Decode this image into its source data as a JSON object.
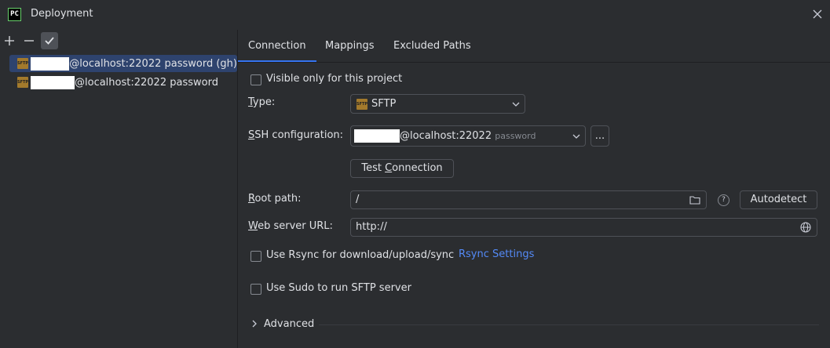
{
  "window": {
    "title": "Deployment",
    "app_icon_text": "PC"
  },
  "left_toolbar": {
    "add": "+",
    "remove": "−",
    "default": "✔"
  },
  "servers": [
    {
      "label": "@localhost:22022 password (gh)",
      "icon": "sftp-icon",
      "selected": true
    },
    {
      "label": "@localhost:22022 password",
      "icon": "sftp-icon",
      "selected": false
    }
  ],
  "tabs": [
    {
      "label": "Connection",
      "active": true
    },
    {
      "label": "Mappings",
      "active": false
    },
    {
      "label": "Excluded Paths",
      "active": false
    }
  ],
  "connection": {
    "visible_only": {
      "label": "Visible only for this project",
      "checked": false
    },
    "type": {
      "label_mnemonic": "T",
      "label_rest": "ype:",
      "value": "SFTP"
    },
    "ssh": {
      "label_mnemonic": "S",
      "label_rest": "SH configuration:",
      "value": "@localhost:22022",
      "hint": "password",
      "more": "..."
    },
    "test_connection": {
      "before": "Test ",
      "mnemonic": "C",
      "after": "onnection"
    },
    "root_path": {
      "label_mnemonic": "R",
      "label_rest": "oot path:",
      "value": "/",
      "autodetect": "Autodetect",
      "help": "?"
    },
    "web_server": {
      "label_mnemonic": "W",
      "label_rest": "eb server URL:",
      "value": "http://"
    },
    "rsync": {
      "label": "Use Rsync for download/upload/sync",
      "checked": false,
      "settings_link": "Rsync Settings"
    },
    "sudo": {
      "label": "Use Sudo to run SFTP server",
      "checked": false
    },
    "advanced": {
      "label": "Advanced",
      "expanded": false
    }
  },
  "colors": {
    "background": "#2b2d30",
    "accent": "#3574f0",
    "selection": "#2e436e",
    "link": "#548af7"
  }
}
